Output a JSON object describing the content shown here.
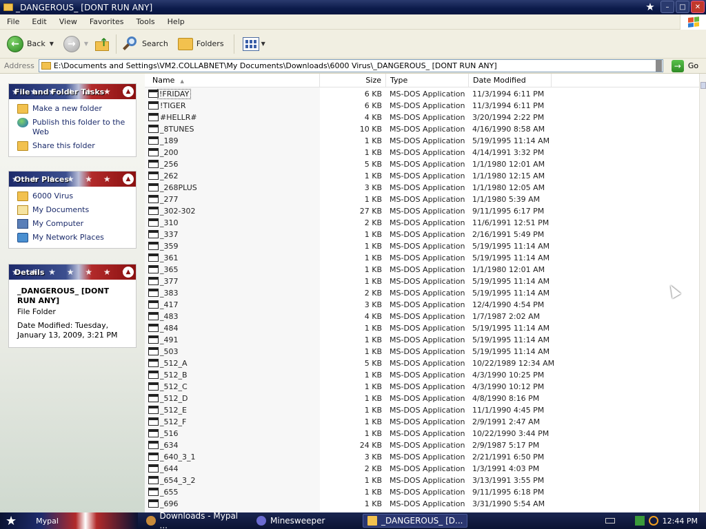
{
  "window": {
    "title": "_DANGEROUS_ [DONT RUN ANY]"
  },
  "menu": [
    "File",
    "Edit",
    "View",
    "Favorites",
    "Tools",
    "Help"
  ],
  "toolbar": {
    "back_label": "Back",
    "search_label": "Search",
    "folders_label": "Folders"
  },
  "address": {
    "label": "Address",
    "value": "E:\\Documents and Settings\\VM2.COLLABNET\\My Documents\\Downloads\\6000 Virus\\_DANGEROUS_ [DONT RUN ANY]",
    "go_label": "Go"
  },
  "tasks_panel": {
    "title": "File and Folder Tasks",
    "items": [
      {
        "label": "Make a new folder",
        "icon": "new-folder-icon"
      },
      {
        "label": "Publish this folder to the Web",
        "icon": "globe-icon"
      },
      {
        "label": "Share this folder",
        "icon": "share-folder-icon"
      }
    ]
  },
  "places_panel": {
    "title": "Other Places",
    "items": [
      {
        "label": "6000 Virus",
        "icon": "folder-icon"
      },
      {
        "label": "My Documents",
        "icon": "my-documents-icon"
      },
      {
        "label": "My Computer",
        "icon": "my-computer-icon"
      },
      {
        "label": "My Network Places",
        "icon": "network-places-icon"
      }
    ]
  },
  "details_panel": {
    "title": "Details",
    "name": "_DANGEROUS_ [DONT RUN ANY]",
    "type": "File Folder",
    "modified": "Date Modified: Tuesday, January 13, 2009, 3:21 PM"
  },
  "columns": {
    "name": "Name",
    "size": "Size",
    "type": "Type",
    "date": "Date Modified"
  },
  "files": [
    {
      "name": "!FRIDAY",
      "size": "6 KB",
      "type": "MS-DOS Application",
      "date": "11/3/1994 6:11 PM"
    },
    {
      "name": "!TIGER",
      "size": "6 KB",
      "type": "MS-DOS Application",
      "date": "11/3/1994 6:11 PM"
    },
    {
      "name": "#HELLR#",
      "size": "4 KB",
      "type": "MS-DOS Application",
      "date": "3/20/1994 2:22 PM"
    },
    {
      "name": "_8TUNES",
      "size": "10 KB",
      "type": "MS-DOS Application",
      "date": "4/16/1990 8:58 AM"
    },
    {
      "name": "_189",
      "size": "1 KB",
      "type": "MS-DOS Application",
      "date": "5/19/1995 11:14 AM"
    },
    {
      "name": "_200",
      "size": "1 KB",
      "type": "MS-DOS Application",
      "date": "4/14/1991 3:32 PM"
    },
    {
      "name": "_256",
      "size": "5 KB",
      "type": "MS-DOS Application",
      "date": "1/1/1980 12:01 AM"
    },
    {
      "name": "_262",
      "size": "1 KB",
      "type": "MS-DOS Application",
      "date": "1/1/1980 12:15 AM"
    },
    {
      "name": "_268PLUS",
      "size": "3 KB",
      "type": "MS-DOS Application",
      "date": "1/1/1980 12:05 AM"
    },
    {
      "name": "_277",
      "size": "1 KB",
      "type": "MS-DOS Application",
      "date": "1/1/1980 5:39 AM"
    },
    {
      "name": "_302-302",
      "size": "27 KB",
      "type": "MS-DOS Application",
      "date": "9/11/1995 6:17 PM"
    },
    {
      "name": "_310",
      "size": "2 KB",
      "type": "MS-DOS Application",
      "date": "11/6/1991 12:51 PM"
    },
    {
      "name": "_337",
      "size": "1 KB",
      "type": "MS-DOS Application",
      "date": "2/16/1991 5:49 PM"
    },
    {
      "name": "_359",
      "size": "1 KB",
      "type": "MS-DOS Application",
      "date": "5/19/1995 11:14 AM"
    },
    {
      "name": "_361",
      "size": "1 KB",
      "type": "MS-DOS Application",
      "date": "5/19/1995 11:14 AM"
    },
    {
      "name": "_365",
      "size": "1 KB",
      "type": "MS-DOS Application",
      "date": "1/1/1980 12:01 AM"
    },
    {
      "name": "_377",
      "size": "1 KB",
      "type": "MS-DOS Application",
      "date": "5/19/1995 11:14 AM"
    },
    {
      "name": "_383",
      "size": "2 KB",
      "type": "MS-DOS Application",
      "date": "5/19/1995 11:14 AM"
    },
    {
      "name": "_417",
      "size": "3 KB",
      "type": "MS-DOS Application",
      "date": "12/4/1990 4:54 PM"
    },
    {
      "name": "_483",
      "size": "4 KB",
      "type": "MS-DOS Application",
      "date": "1/7/1987 2:02 AM"
    },
    {
      "name": "_484",
      "size": "1 KB",
      "type": "MS-DOS Application",
      "date": "5/19/1995 11:14 AM"
    },
    {
      "name": "_491",
      "size": "1 KB",
      "type": "MS-DOS Application",
      "date": "5/19/1995 11:14 AM"
    },
    {
      "name": "_503",
      "size": "1 KB",
      "type": "MS-DOS Application",
      "date": "5/19/1995 11:14 AM"
    },
    {
      "name": "_512_A",
      "size": "5 KB",
      "type": "MS-DOS Application",
      "date": "10/22/1989 12:34 AM"
    },
    {
      "name": "_512_B",
      "size": "1 KB",
      "type": "MS-DOS Application",
      "date": "4/3/1990 10:25 PM"
    },
    {
      "name": "_512_C",
      "size": "1 KB",
      "type": "MS-DOS Application",
      "date": "4/3/1990 10:12 PM"
    },
    {
      "name": "_512_D",
      "size": "1 KB",
      "type": "MS-DOS Application",
      "date": "4/8/1990 8:16 PM"
    },
    {
      "name": "_512_E",
      "size": "1 KB",
      "type": "MS-DOS Application",
      "date": "11/1/1990 4:45 PM"
    },
    {
      "name": "_512_F",
      "size": "1 KB",
      "type": "MS-DOS Application",
      "date": "2/9/1991 2:47 AM"
    },
    {
      "name": "_516",
      "size": "1 KB",
      "type": "MS-DOS Application",
      "date": "10/22/1990 3:44 PM"
    },
    {
      "name": "_634",
      "size": "24 KB",
      "type": "MS-DOS Application",
      "date": "2/9/1987 5:17 PM"
    },
    {
      "name": "_640_3_1",
      "size": "3 KB",
      "type": "MS-DOS Application",
      "date": "2/21/1991 6:50 PM"
    },
    {
      "name": "_644",
      "size": "2 KB",
      "type": "MS-DOS Application",
      "date": "1/3/1991 4:03 PM"
    },
    {
      "name": "_654_3_2",
      "size": "1 KB",
      "type": "MS-DOS Application",
      "date": "3/13/1991 3:55 PM"
    },
    {
      "name": "_655",
      "size": "1 KB",
      "type": "MS-DOS Application",
      "date": "9/11/1995 6:18 PM"
    },
    {
      "name": "_696",
      "size": "1 KB",
      "type": "MS-DOS Application",
      "date": "3/31/1990 5:54 AM"
    }
  ],
  "taskbar": {
    "start_label": "Mypal",
    "items": [
      {
        "label": "Downloads - Mypal ...",
        "icon": "mypal-icon",
        "active": false
      },
      {
        "label": "Minesweeper",
        "icon": "minesweeper-icon",
        "active": false
      },
      {
        "label": "_DANGEROUS_ [D...",
        "icon": "folder-icon",
        "active": true
      }
    ],
    "clock": "12:44 PM"
  },
  "colors": {
    "titlebar": "#0b1a4a",
    "chrome": "#f1efe2",
    "link": "#1a2a6a",
    "panel_head_left": "#1d2b6b",
    "panel_head_right": "#8a1010"
  }
}
